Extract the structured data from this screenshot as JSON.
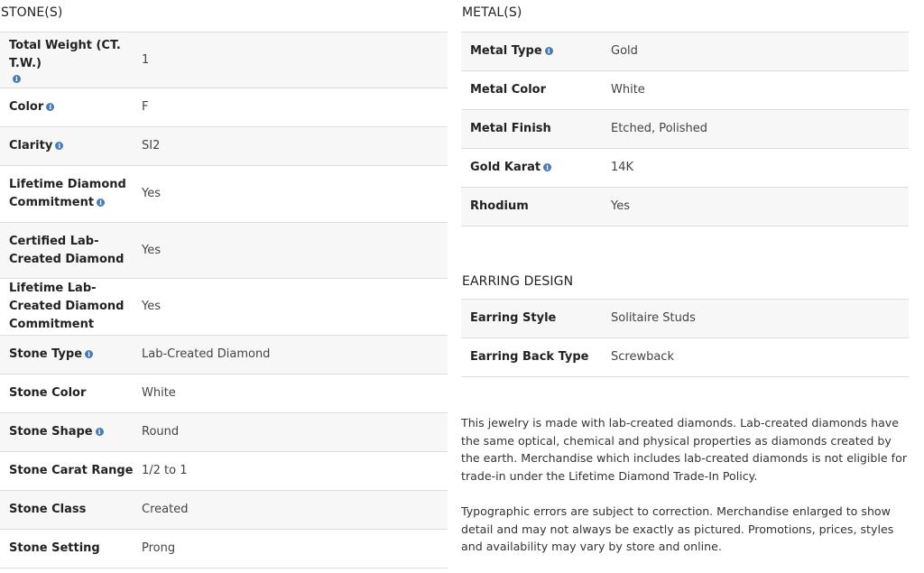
{
  "stones": {
    "title": "STONE(S)",
    "rows": [
      {
        "label": "Total Weight (CT. T.W.)",
        "value": "1",
        "info": true
      },
      {
        "label": "Color",
        "value": "F",
        "info": true
      },
      {
        "label": "Clarity",
        "value": "SI2",
        "info": true
      },
      {
        "label": "Lifetime Diamond Commitment",
        "value": "Yes",
        "info": true
      },
      {
        "label": "Certified Lab-Created Diamond",
        "value": "Yes",
        "info": false
      },
      {
        "label": "Lifetime Lab-Created Diamond Commitment",
        "value": "Yes",
        "info": false
      },
      {
        "label": "Stone Type",
        "value": "Lab-Created Diamond",
        "info": true
      },
      {
        "label": "Stone Color",
        "value": "White",
        "info": false
      },
      {
        "label": "Stone Shape",
        "value": "Round",
        "info": true
      },
      {
        "label": "Stone Carat Range",
        "value": "1/2 to 1",
        "info": false
      },
      {
        "label": "Stone Class",
        "value": "Created",
        "info": false
      },
      {
        "label": "Stone Setting",
        "value": "Prong",
        "info": false
      }
    ]
  },
  "metals": {
    "title": "METAL(S)",
    "rows": [
      {
        "label": "Metal Type",
        "value": "Gold",
        "info": true
      },
      {
        "label": "Metal Color",
        "value": "White",
        "info": false
      },
      {
        "label": "Metal Finish",
        "value": "Etched, Polished",
        "info": false
      },
      {
        "label": "Gold Karat",
        "value": "14K",
        "info": true
      },
      {
        "label": "Rhodium",
        "value": "Yes",
        "info": false
      }
    ]
  },
  "earring_design": {
    "title": "EARRING DESIGN",
    "rows": [
      {
        "label": "Earring Style",
        "value": "Solitaire Studs",
        "info": false
      },
      {
        "label": "Earring Back Type",
        "value": "Screwback",
        "info": false
      }
    ]
  },
  "notes": {
    "lab_created": "This jewelry is made with lab-created diamonds. Lab-created diamonds have the same optical, chemical and physical properties as diamonds created by the earth. Merchandise which includes lab-created diamonds is not eligible for trade-in under the Lifetime Diamond Trade-In Policy.",
    "disclaimer": "Typographic errors are subject to correction. Merchandise enlarged to show detail and may not always be exactly as pictured. Promotions, prices, styles and availability may vary by store and online."
  },
  "icons": {
    "info_icon": "info-circle-icon",
    "info_glyph": "i",
    "info_color": "#4a79b8"
  }
}
